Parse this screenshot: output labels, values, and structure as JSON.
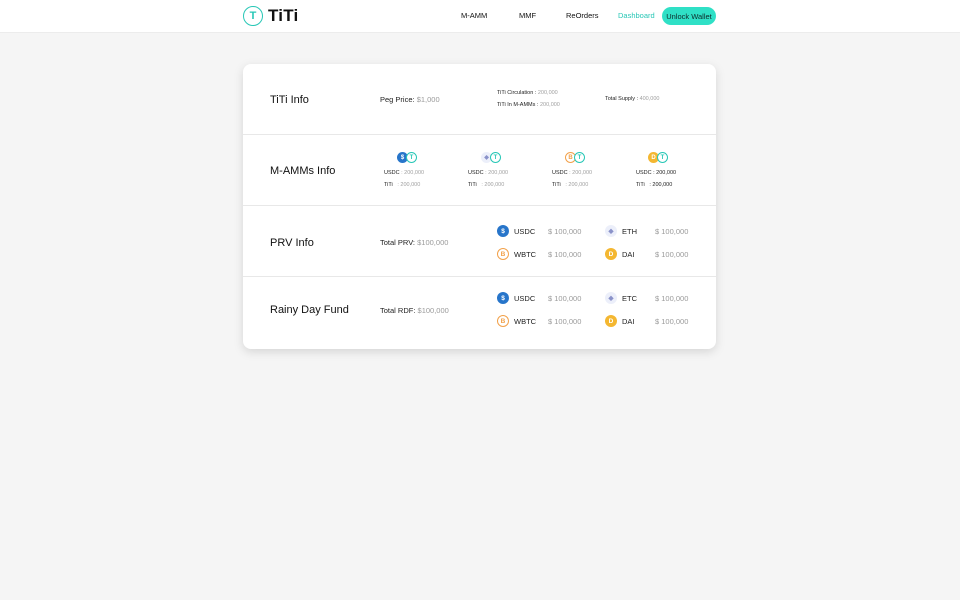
{
  "header": {
    "logo_text": "TiTi",
    "logo_letter": "T",
    "nav": [
      "M-AMM",
      "MMF",
      "ReOrders",
      "Dashboard"
    ],
    "unlock_wallet": "Unlock Wallet",
    "accent_color": "#2fe0c6"
  },
  "titi_info": {
    "title": "TiTi Info",
    "peg_label": "Peg Price:",
    "peg_value": "$1,000",
    "circulation_label": "TiTi Circulation :",
    "circulation_value": "200,000",
    "in_mamms_label": "TiTi In M-AMMs :",
    "in_mamms_value": "200,000",
    "supply_label": "Total Supply :",
    "supply_value": "400,000"
  },
  "mamms_info": {
    "title": "M-AMMs Info",
    "pools": [
      {
        "icon": "usdc-icon",
        "usdc_label": "USDC",
        "usdc_value": ": 200,000",
        "titi_label": "TiTi",
        "titi_value": ": 200,000"
      },
      {
        "icon": "eth-icon",
        "usdc_label": "USDC",
        "usdc_value": ": 200,000",
        "titi_label": "TiTi",
        "titi_value": ": 200,000"
      },
      {
        "icon": "wbtc-icon",
        "usdc_label": "USDC",
        "usdc_value": ": 200,000",
        "titi_label": "TiTi",
        "titi_value": ": 200,000"
      },
      {
        "icon": "dai-icon",
        "usdc_label": "USDC",
        "usdc_value": ": 200,000",
        "titi_label": "TiTi",
        "titi_value": ": 200,000"
      }
    ]
  },
  "prv_info": {
    "title": "PRV Info",
    "total_label": "Total PRV:",
    "total_value": "$100,000",
    "tokens": [
      {
        "name": "USDC",
        "value": "$ 100,000",
        "icon": "usdc-icon"
      },
      {
        "name": "ETH",
        "value": "$ 100,000",
        "icon": "eth-icon"
      },
      {
        "name": "WBTC",
        "value": "$ 100,000",
        "icon": "wbtc-icon"
      },
      {
        "name": "DAI",
        "value": "$ 100,000",
        "icon": "dai-icon"
      }
    ]
  },
  "rdf_info": {
    "title": "Rainy Day Fund",
    "total_label": "Total RDF:",
    "total_value": "$100,000",
    "tokens": [
      {
        "name": "USDC",
        "value": "$ 100,000",
        "icon": "usdc-icon"
      },
      {
        "name": "ETC",
        "value": "$ 100,000",
        "icon": "etc-icon"
      },
      {
        "name": "WBTC",
        "value": "$ 100,000",
        "icon": "wbtc-icon"
      },
      {
        "name": "DAI",
        "value": "$ 100,000",
        "icon": "dai-icon"
      }
    ]
  }
}
